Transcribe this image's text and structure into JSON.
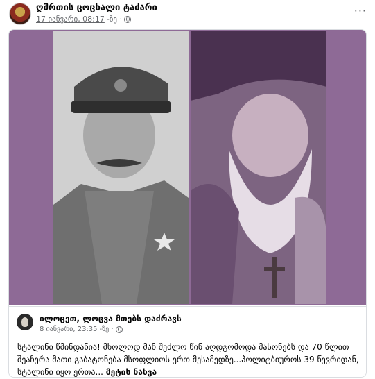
{
  "post": {
    "page_name": "ღმრთის ცოცხალი ტაძარი",
    "date": "17 იანვარი, 08:17",
    "date_suffix": "-ზე ·",
    "more_label": "···"
  },
  "shared_post": {
    "author": "ილოცეთ, ლოცვა მთებს დაძრავს",
    "date": "8 იანვარი, 23:35",
    "date_suffix": "-ზე ·",
    "text": "სტალინი წმინდანია! მხოლოდ მან შეძლო წინ აღდგომოდა მასონებს და 70 წლით შეაჩერა მათი გაბატონება მსოფლიოს ერთ მესამედზე...პოლიტბიუროს 39 წევრიდან, სტალინი იყო ერთა...",
    "see_more": "მეტის ნახვა"
  },
  "colors": {
    "media_background": "#8e6a96",
    "meta_text": "#65676b"
  },
  "icons": [
    "globe-icon",
    "more-options-icon"
  ]
}
